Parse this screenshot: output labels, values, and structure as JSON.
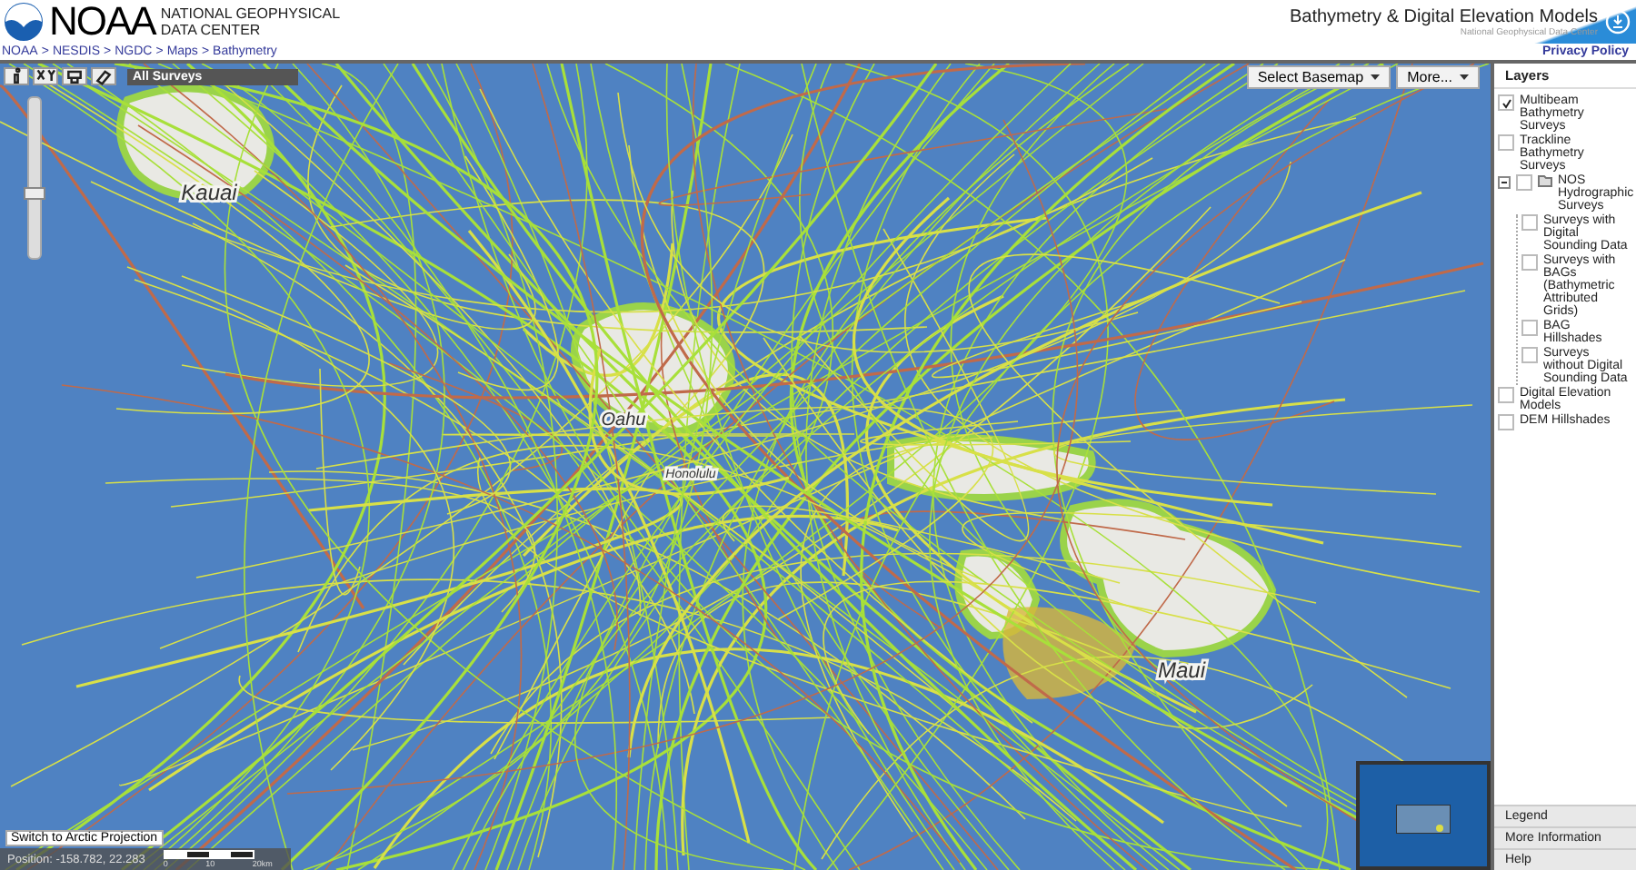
{
  "header": {
    "org_short": "NOAA",
    "org_name": "NATIONAL GEOPHYSICAL DATA CENTER",
    "app_title": "Bathymetry & Digital Elevation Models",
    "app_sub": "National Geophysical Data Center",
    "privacy": "Privacy Policy"
  },
  "breadcrumb": [
    "NOAA",
    "NESDIS",
    "NGDC",
    "Maps",
    "Bathymetry"
  ],
  "breadcrumb_sep": ">",
  "map": {
    "layer_label": "All Surveys",
    "basemap_button": "Select Basemap",
    "more_button": "More...",
    "zoom_slider": {
      "level": 0.4
    },
    "labels": [
      {
        "text": "Kauai"
      },
      {
        "text": "Oahu"
      },
      {
        "text": "Honolulu"
      },
      {
        "text": "Maui"
      }
    ],
    "projection_button": "Switch to Arctic Projection",
    "position": "Position: -158.782, 22.283",
    "scale": [
      "0",
      "10",
      "20km"
    ]
  },
  "layers": {
    "title": "Layers",
    "items": [
      {
        "label": "Multibeam Bathymetry Surveys",
        "checked": true
      },
      {
        "label": "Trackline Bathymetry Surveys",
        "checked": false
      },
      {
        "label": "NOS Hydrographic Surveys",
        "checked": false,
        "expanded": true,
        "children": [
          {
            "label": "Surveys with Digital Sounding Data",
            "checked": false
          },
          {
            "label": "Surveys with BAGs (Bathymetric Attributed Grids)",
            "checked": false
          },
          {
            "label": "BAG Hillshades",
            "checked": false
          },
          {
            "label": "Surveys without Digital Sounding Data",
            "checked": false
          }
        ]
      },
      {
        "label": "Digital Elevation Models",
        "checked": false
      },
      {
        "label": "DEM Hillshades",
        "checked": false
      }
    ],
    "footer": [
      "Legend",
      "More Information",
      "Help"
    ]
  }
}
